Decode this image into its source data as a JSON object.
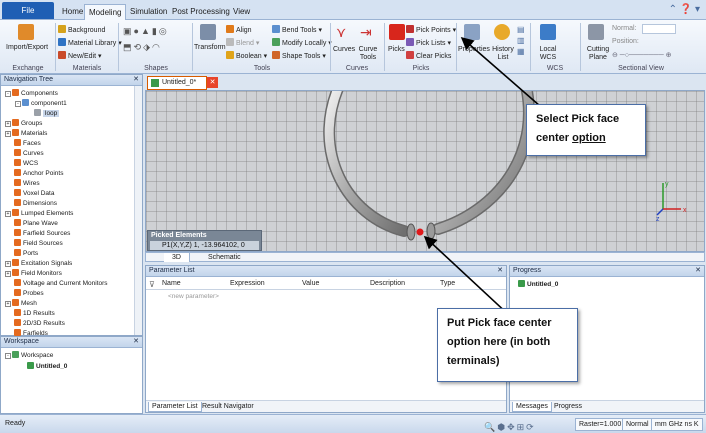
{
  "tabs": {
    "file": "File",
    "home": "Home",
    "modeling": "Modeling",
    "simulation": "Simulation",
    "post_processing": "Post Processing",
    "view": "View"
  },
  "ribbon": {
    "import_export": "Import/Export",
    "background": "Background",
    "material_library": "Material Library",
    "new_edit": "New/Edit",
    "transform": "Transform",
    "align": "Align",
    "blend": "Blend",
    "boolean": "Boolean",
    "bend_tools": "Bend Tools",
    "modify_locally": "Modify Locally",
    "shape_tools": "Shape Tools",
    "curves": "Curves",
    "curve_tools": "Curve Tools",
    "picks": "Picks",
    "pick_points": "Pick Points",
    "pick_lists": "Pick Lists",
    "clear_picks": "Clear Picks",
    "properties": "Properties",
    "history_list": "History List",
    "local_wcs": "Local WCS",
    "cutting_plane": "Cutting Plane",
    "normal_label": "Normal:",
    "position_label": "Position:",
    "groups": {
      "exchange": "Exchange",
      "materials": "Materials",
      "shapes": "Shapes",
      "tools": "Tools",
      "curves": "Curves",
      "picks": "Picks",
      "wcs": "WCS",
      "sectional_view": "Sectional View"
    }
  },
  "nav": {
    "title": "Navigation Tree",
    "items": [
      "Components",
      "component1",
      "loop",
      "Groups",
      "Materials",
      "Faces",
      "Curves",
      "WCS",
      "Anchor Points",
      "Wires",
      "Voxel Data",
      "Dimensions",
      "Lumped Elements",
      "Plane Wave",
      "Farfield Sources",
      "Field Sources",
      "Ports",
      "Excitation Signals",
      "Field Monitors",
      "Voltage and Current Monitors",
      "Probes",
      "Mesh",
      "1D Results",
      "2D/3D Results",
      "Farfields"
    ]
  },
  "workspace": {
    "title": "Workspace",
    "root": "Workspace",
    "project": "Untitled_0"
  },
  "doc_tab": "Untitled_0*",
  "picked": {
    "title": "Picked Elements",
    "row": "P1(X,Y,Z)   1, -13.964102, 0"
  },
  "view_tabs": {
    "t3d": "3D",
    "schematic": "Schematic"
  },
  "param_list": {
    "title": "Parameter List",
    "columns": {
      "name": "Name",
      "expression": "Expression",
      "value": "Value",
      "description": "Description",
      "type": "Type"
    },
    "new_param": "<new parameter>",
    "tabs": {
      "param_list": "Parameter List",
      "result_navigator": "Result Navigator"
    }
  },
  "progress": {
    "title": "Progress",
    "item": "Untitled_0",
    "tabs": {
      "messages": "Messages",
      "progress": "Progress"
    }
  },
  "annotations": {
    "select_line1": "Select Pick face",
    "select_line2": "center",
    "select_word": "option",
    "put_line1": "Put Pick face center",
    "put_line2": "option here (in both",
    "put_line3": "terminals)"
  },
  "status": {
    "ready": "Ready",
    "raster": "Raster=1.000",
    "normal": "Normal",
    "units": "mm  GHz  ns  K"
  },
  "colors": {
    "file_tab": "#1f5fb4",
    "accent": "#d85b00",
    "pick_dot": "#e0191b"
  }
}
